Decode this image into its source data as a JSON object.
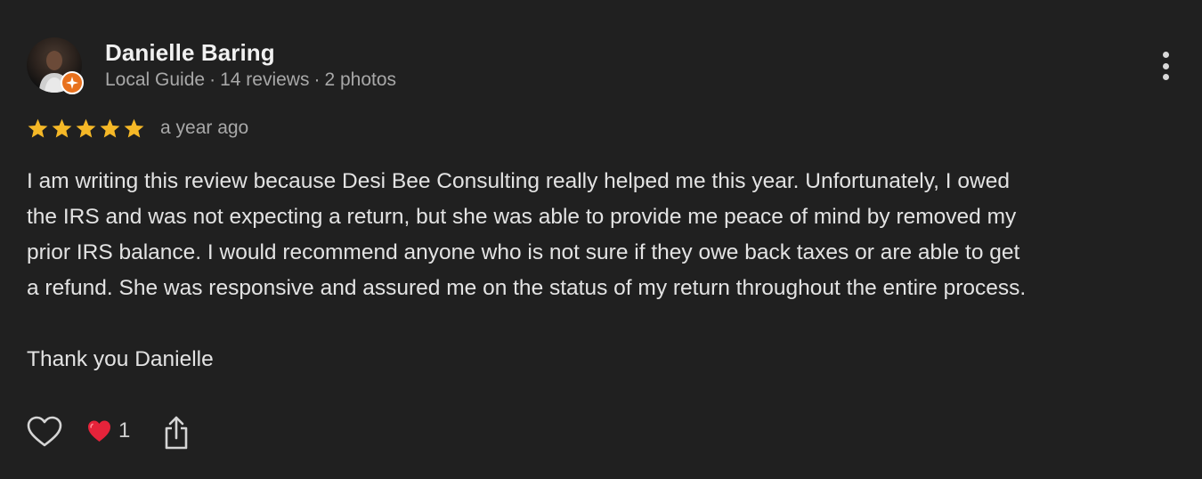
{
  "reviewer": {
    "name": "Danielle Baring",
    "guide_label": "Local Guide",
    "separator": "·",
    "reviews": "14 reviews",
    "photos": "2 photos",
    "badge_color": "#e8711e"
  },
  "review": {
    "stars": 5,
    "max_stars": 5,
    "star_color": "#f5b827",
    "time": "a year ago",
    "body": "I am writing this review because Desi Bee Consulting really helped me this year. Unfortunately, I owed\nthe IRS and was not expecting a return, but she was able to provide me peace of mind by removed my\nprior IRS balance. I would recommend anyone who is not sure if they owe back taxes or are able to get\na refund. She was responsive and assured me on the status of my return throughout the entire process.",
    "signoff": "Thank you Danielle"
  },
  "actions": {
    "like_icon": "heart-outline-icon",
    "reaction_icon": "red-heart-emoji",
    "reaction_count": "1",
    "share_icon": "share-icon"
  },
  "menu": {
    "icon": "more-vert-icon"
  }
}
